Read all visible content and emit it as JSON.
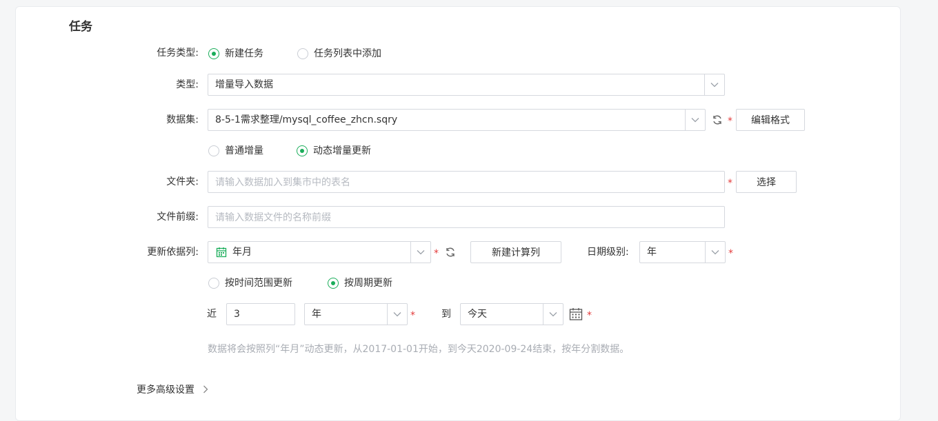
{
  "section_title": "任务",
  "task_type": {
    "label": "任务类型:",
    "options": [
      "新建任务",
      "任务列表中添加"
    ],
    "selected": 0
  },
  "type": {
    "label": "类型:",
    "value": "增量导入数据"
  },
  "dataset": {
    "label": "数据集:",
    "value": "8-5-1需求整理/mysql_coffee_zhcn.sqry",
    "edit_button": "编辑格式",
    "mode_options": [
      "普通增量",
      "动态增量更新"
    ],
    "mode_selected": 1
  },
  "folder": {
    "label": "文件夹:",
    "placeholder": "请输入数据加入到集市中的表名",
    "select_button": "选择"
  },
  "file_prefix": {
    "label": "文件前缀:",
    "placeholder": "请输入数据文件的名称前缀"
  },
  "update_column": {
    "label": "更新依据列:",
    "value": "年月",
    "new_calc_button": "新建计算列",
    "date_level_label": "日期级别:",
    "date_level_value": "年"
  },
  "update_mode": {
    "options": [
      "按时间范围更新",
      "按周期更新"
    ],
    "selected": 1
  },
  "period": {
    "recent_label": "近",
    "count_value": "3",
    "unit_value": "年",
    "to_label": "到",
    "end_value": "今天"
  },
  "hint_text": "数据将会按照列“年月”动态更新，从2017-01-01开始，到今天2020-09-24结束，按年分割数据。",
  "advanced": {
    "label": "更多高级设置"
  },
  "required_mark": "*",
  "colors": {
    "accent": "#1aad5a",
    "required": "#e33c3c",
    "border": "#d5d8de"
  }
}
